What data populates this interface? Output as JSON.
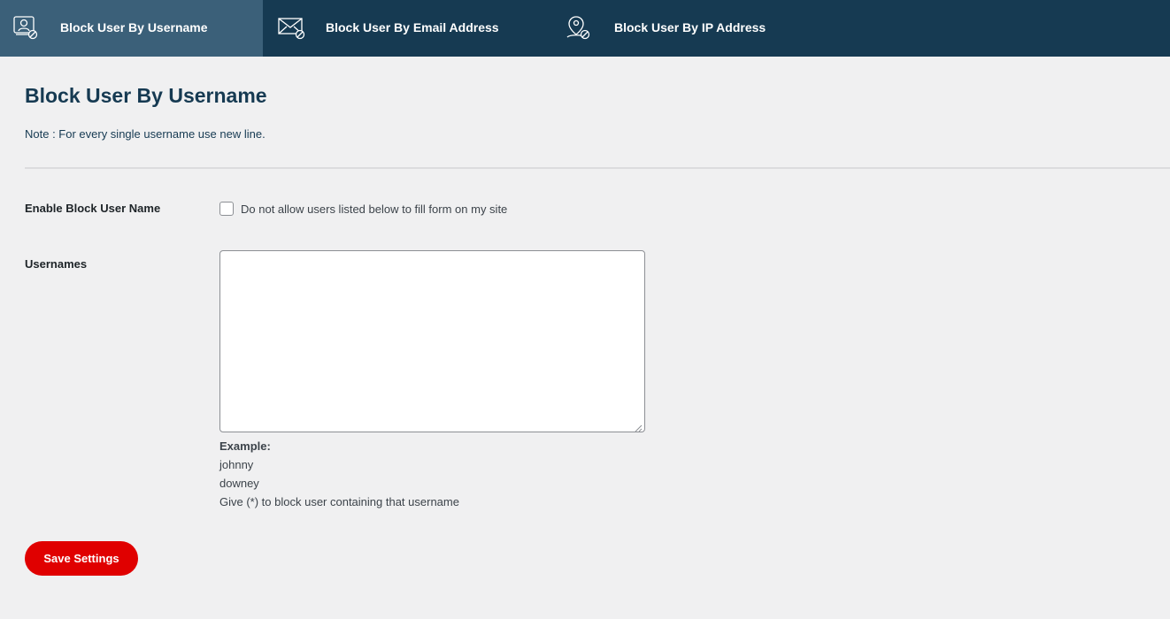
{
  "tabs": [
    {
      "label": "Block User By Username",
      "icon": "user-block-icon",
      "active": true
    },
    {
      "label": "Block User By Email Address",
      "icon": "email-block-icon",
      "active": false
    },
    {
      "label": "Block User By IP Address",
      "icon": "location-block-icon",
      "active": false
    }
  ],
  "page": {
    "title": "Block User By Username",
    "note": "Note : For every single username use new line."
  },
  "form": {
    "enable_label": "Enable Block User Name",
    "enable_checkbox_text": "Do not allow users listed below to fill form on my site",
    "enable_checked": false,
    "usernames_label": "Usernames",
    "usernames_value": "",
    "example_heading": "Example:",
    "example_lines": [
      "johnny",
      "downey",
      "Give (*) to block user containing that username"
    ]
  },
  "actions": {
    "save_label": "Save Settings"
  },
  "colors": {
    "tabbar_bg": "#163a52",
    "active_tab_bg": "#3b6079",
    "title_color": "#163a52",
    "save_button_bg": "#e00000"
  }
}
